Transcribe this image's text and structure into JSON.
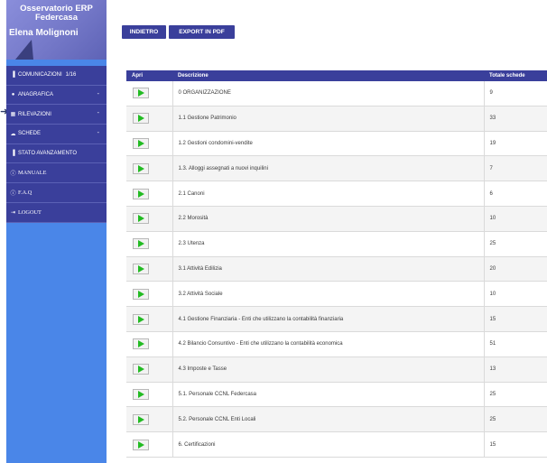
{
  "sidebar": {
    "title_line1": "Osservatorio ERP",
    "title_line2": "Federcasa",
    "user": "Elena Molignoni",
    "items": [
      {
        "icon": "bar-chart-icon",
        "label": "COMUNICAZIONI",
        "count": "1/16"
      },
      {
        "icon": "user-icon",
        "label": "ANAGRAFICA",
        "dash": "-"
      },
      {
        "icon": "table-icon",
        "label": "RILEVAZIONI",
        "dash": "-"
      },
      {
        "icon": "cloud-icon",
        "label": "SCHEDE",
        "dash": "-"
      },
      {
        "icon": "bar-chart-icon",
        "label": "STATO AVANZAMENTO"
      },
      {
        "icon": "info-icon",
        "label": "MANUALE"
      },
      {
        "icon": "info-icon",
        "label": "F.A.Q"
      },
      {
        "icon": "logout-icon",
        "label": "LOGOUT"
      }
    ]
  },
  "toolbar": {
    "back_label": "INDIETRO",
    "export_label": "EXPORT IN PDF"
  },
  "table": {
    "headers": [
      "Apri",
      "Descrizione",
      "Totale schede"
    ],
    "rows": [
      {
        "desc": "0 ORGANIZZAZIONE",
        "total": "9"
      },
      {
        "desc": "1.1 Gestione Patrimonio",
        "total": "33"
      },
      {
        "desc": "1.2 Gestioni condomini-vendite",
        "total": "19"
      },
      {
        "desc": "1.3. Alloggi assegnati a nuovi inquilini",
        "total": "7"
      },
      {
        "desc": "2.1 Canoni",
        "total": "6"
      },
      {
        "desc": "2.2 Morosità",
        "total": "10"
      },
      {
        "desc": "2.3 Utenza",
        "total": "25"
      },
      {
        "desc": "3.1 Attività Edilizia",
        "total": "20"
      },
      {
        "desc": "3.2 Attività Sociale",
        "total": "10"
      },
      {
        "desc": "4.1 Gestione Finanziaria - Enti che utilizzano la contabilità finanziaria",
        "total": "15"
      },
      {
        "desc": "4.2 Bilancio Consuntivo - Enti che utilizzano la contabilità economica",
        "total": "51"
      },
      {
        "desc": "4.3 Imposte e Tasse",
        "total": "13"
      },
      {
        "desc": "5.1. Personale CCNL Federcasa",
        "total": "25"
      },
      {
        "desc": "5.2. Personale CCNL Enti Locali",
        "total": "25"
      },
      {
        "desc": "6. Certificazioni",
        "total": "15"
      }
    ]
  }
}
